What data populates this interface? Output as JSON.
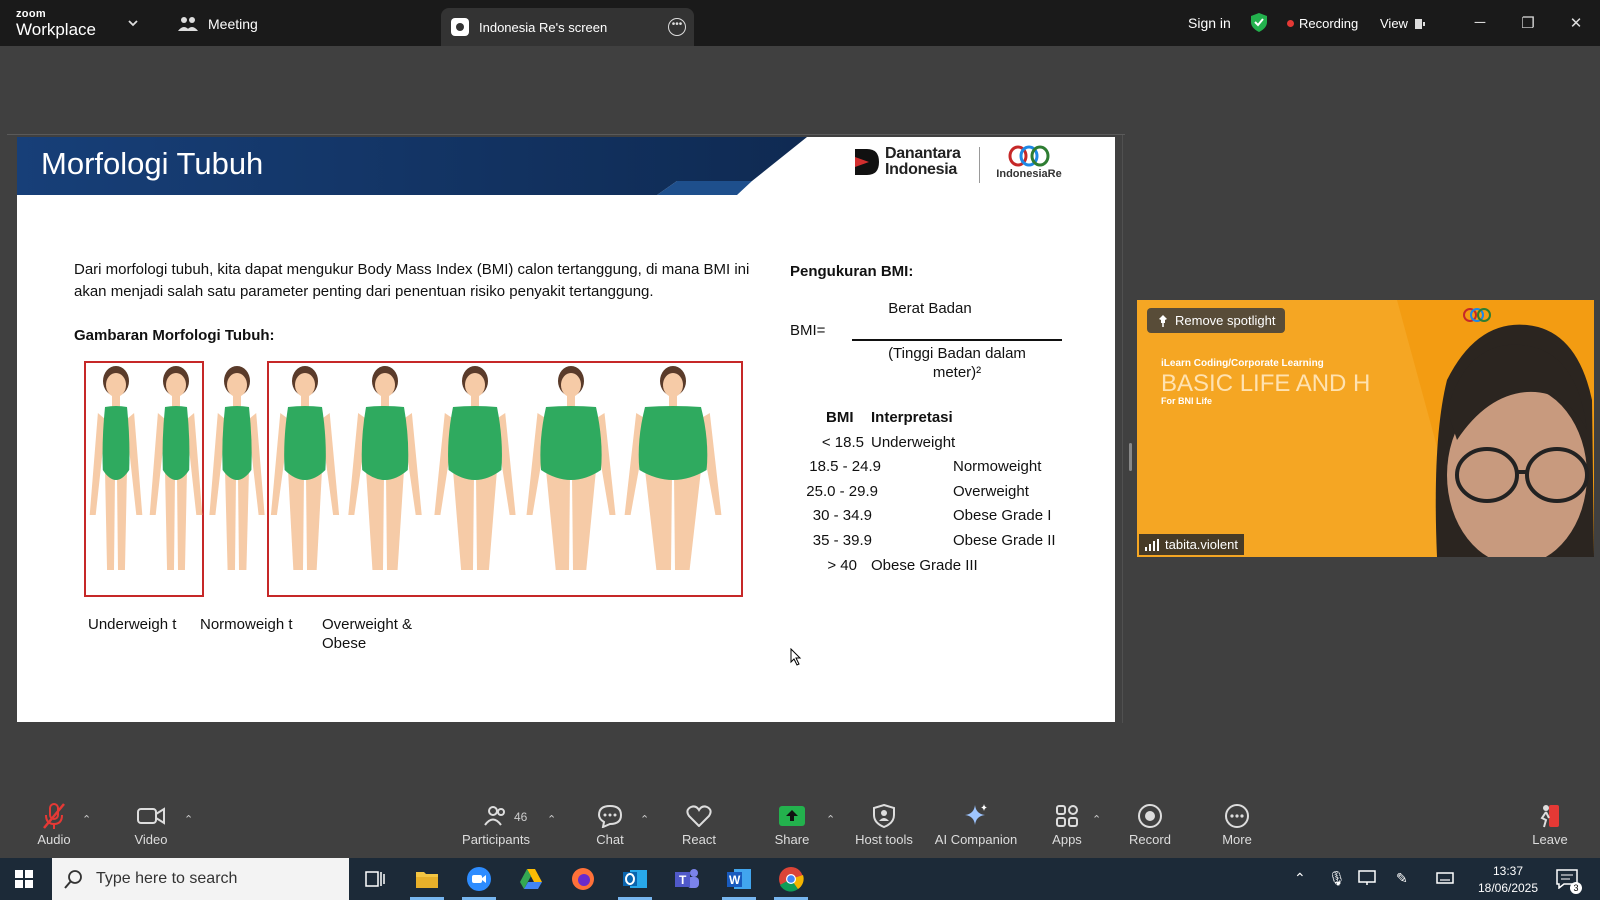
{
  "app": {
    "brand_top": "zoom",
    "brand_bottom": "Workplace"
  },
  "header": {
    "meeting_label": "Meeting",
    "tab_label": "Indonesia Re's screen",
    "sign_in": "Sign in",
    "recording": "Recording",
    "view": "View"
  },
  "slide": {
    "title": "Morfologi Tubuh",
    "logo_left": [
      "Danantara",
      "Indonesia"
    ],
    "logo_right": "IndonesiaRe",
    "paragraph": "Dari morfologi tubuh, kita dapat mengukur Body Mass Index (BMI) calon tertanggung, di mana BMI ini akan menjadi salah satu parameter penting dari penentuan risiko penyakit tertanggung.",
    "subheading": "Gambaran Morfologi Tubuh:",
    "captions": [
      "Underweigh t",
      "Normoweigh t",
      "Overweight & Obese"
    ],
    "bmi_heading": "Pengukuran BMI:",
    "bmi_label": "BMI=",
    "numerator": "Berat Badan",
    "denominator": "(Tinggi Badan dalam meter)²",
    "table_header": {
      "bmi": "BMI",
      "interp": "Interpretasi"
    },
    "rows": [
      {
        "range": "< 18.5",
        "label": "Underweight"
      },
      {
        "range": "18.5 - 24.9",
        "label": "Normoweight"
      },
      {
        "range": "25.0 - 29.9",
        "label": "Overweight"
      },
      {
        "range": "30 - 34.9",
        "label": "Obese Grade I"
      },
      {
        "range": "35 - 39.9",
        "label": "Obese Grade II"
      },
      {
        "range": "> 40",
        "label": "Obese Grade III"
      }
    ]
  },
  "video": {
    "remove_spotlight": "Remove spotlight",
    "line1": "iLearn Coding/Corporate Learning",
    "line2": "BASIC LIFE AND H",
    "line3": "For BNI Life",
    "participant_name": "tabita.violent"
  },
  "toolbar": {
    "audio": "Audio",
    "video": "Video",
    "participants": "Participants",
    "participants_count": "46",
    "chat": "Chat",
    "react": "React",
    "share": "Share",
    "host_tools": "Host tools",
    "ai_companion": "AI Companion",
    "apps": "Apps",
    "record": "Record",
    "more": "More",
    "leave": "Leave"
  },
  "taskbar": {
    "search_placeholder": "Type here to search",
    "time": "13:37",
    "date": "18/06/2025",
    "notifications": "3"
  },
  "colors": {
    "slide_header": "#163a6b",
    "figure_border": "#c62828",
    "body_green": "#2faa5f",
    "video_bg": "#f5a623"
  }
}
